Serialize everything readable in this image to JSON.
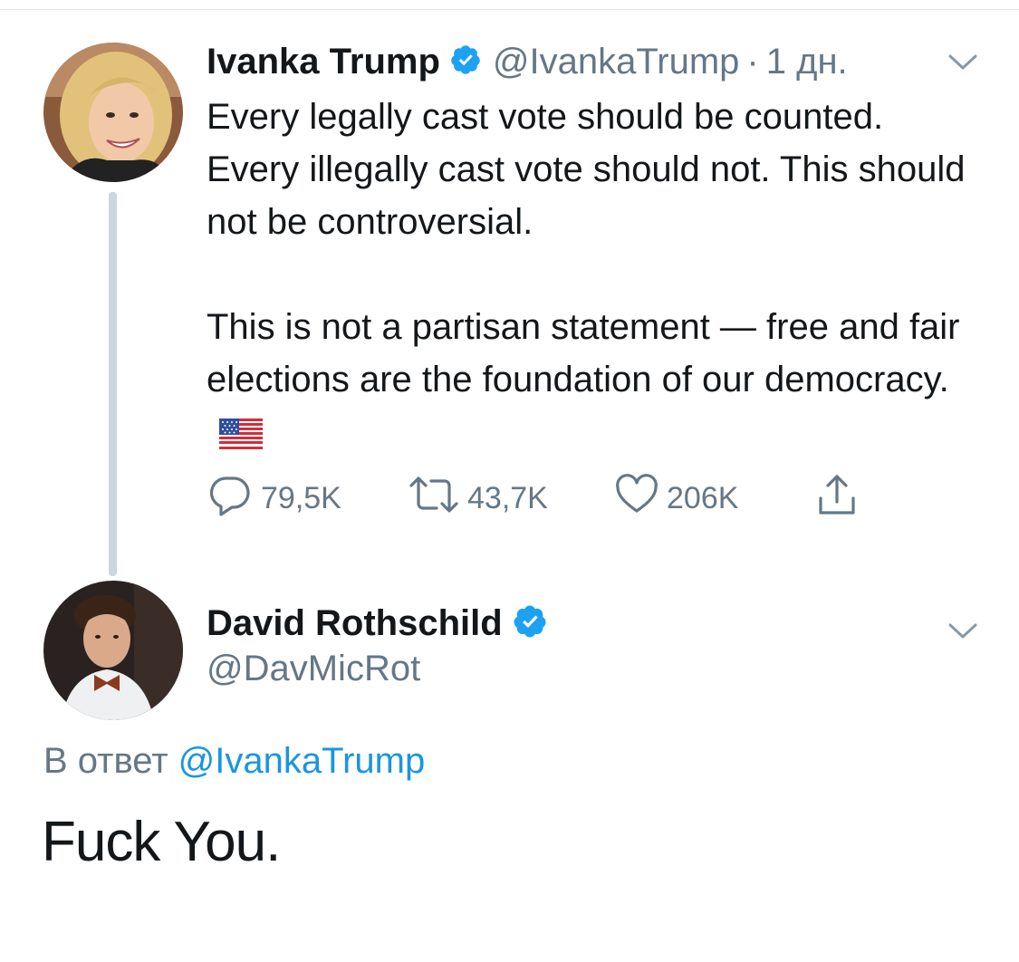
{
  "tweet": {
    "author": {
      "display_name": "Ivanka Trump",
      "handle": "@IvankaTrump",
      "verified": true,
      "avatar_icon": "avatar-blonde-woman"
    },
    "separator": "·",
    "time": "1 дн.",
    "text_paragraph_1": "Every legally cast vote should be counted. Every illegally cast vote should not. This should not be controversial.",
    "text_paragraph_2": "This is not a partisan statement — free and fair elections are the foundation of our democracy.",
    "emoji": "us-flag-emoji",
    "actions": {
      "replies": "79,5K",
      "retweets": "43,7K",
      "likes": "206K"
    }
  },
  "reply": {
    "author": {
      "display_name": "David Rothschild",
      "handle": "@DavMicRot",
      "verified": true,
      "avatar_icon": "avatar-man-bowtie"
    },
    "reply_to_label": "В ответ",
    "reply_to_handle": "@IvankaTrump",
    "text": "Fuck You."
  },
  "colors": {
    "verified_blue": "#1da1f2",
    "secondary_text": "#657786",
    "link": "#1b95e0",
    "thread_line": "#ccd6dd"
  }
}
